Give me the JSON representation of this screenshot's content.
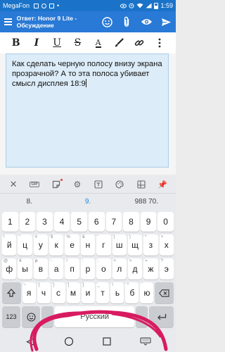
{
  "status": {
    "carrier": "MegaFon",
    "time": "1:59"
  },
  "appbar": {
    "title": "Ответ: Honor 9 Lite - Обсуждение"
  },
  "fmt": {
    "bold": "B",
    "italic": "I",
    "underline": "U",
    "strike": "S",
    "font_size": "A"
  },
  "editor": {
    "text": "Как сделать черную полосу внизу экрана прозрачной? А то эта полоса убивает смысл дисплея 18:9"
  },
  "keyboard": {
    "gif_label": "GIF",
    "suggestions": [
      "8.",
      "9.",
      "988 70."
    ],
    "row1": [
      {
        "k": "1"
      },
      {
        "k": "2"
      },
      {
        "k": "3"
      },
      {
        "k": "4"
      },
      {
        "k": "5"
      },
      {
        "k": "6"
      },
      {
        "k": "7"
      },
      {
        "k": "8"
      },
      {
        "k": "9"
      },
      {
        "k": "0"
      }
    ],
    "row2": [
      {
        "k": "й",
        "h": "!"
      },
      {
        "k": "ц",
        "h": "\""
      },
      {
        "k": "у",
        "h": "#"
      },
      {
        "k": "к",
        "h": "$"
      },
      {
        "k": "е",
        "h": "%"
      },
      {
        "k": "н",
        "h": "&"
      },
      {
        "k": "г",
        "h": "'"
      },
      {
        "k": "ш",
        "h": "("
      },
      {
        "k": "щ",
        "h": ")"
      },
      {
        "k": "з",
        "h": "*"
      },
      {
        "k": "х",
        "h": "+"
      }
    ],
    "row3": [
      {
        "k": "ф",
        "h": "@"
      },
      {
        "k": "ы",
        "h": "€"
      },
      {
        "k": "в",
        "h": "₽"
      },
      {
        "k": "а",
        "h": "-"
      },
      {
        "k": "п",
        "h": "/"
      },
      {
        "k": "р",
        "h": ":"
      },
      {
        "k": "о",
        "h": ";"
      },
      {
        "k": "л",
        "h": "<"
      },
      {
        "k": "д",
        "h": ">"
      },
      {
        "k": "ж",
        "h": "="
      },
      {
        "k": "э",
        "h": "?"
      }
    ],
    "row4": [
      {
        "k": "я",
        "h": "~"
      },
      {
        "k": "ч",
        "h": "{"
      },
      {
        "k": "с",
        "h": "}"
      },
      {
        "k": "м",
        "h": "["
      },
      {
        "k": "и",
        "h": "]"
      },
      {
        "k": "т",
        "h": "_"
      },
      {
        "k": "ь",
        "h": "\\"
      },
      {
        "k": "б",
        "h": "^"
      },
      {
        "k": "ю",
        "h": "`"
      }
    ],
    "symbols": "123",
    "space": "Русский",
    "period": ".",
    "comma": ","
  },
  "colors": {
    "primary": "#2979d6",
    "statusbar": "#1a73c9",
    "editor_bg": "#dcecf8",
    "suggest_accent": "#1e88e5",
    "scribble": "#d81b60"
  }
}
